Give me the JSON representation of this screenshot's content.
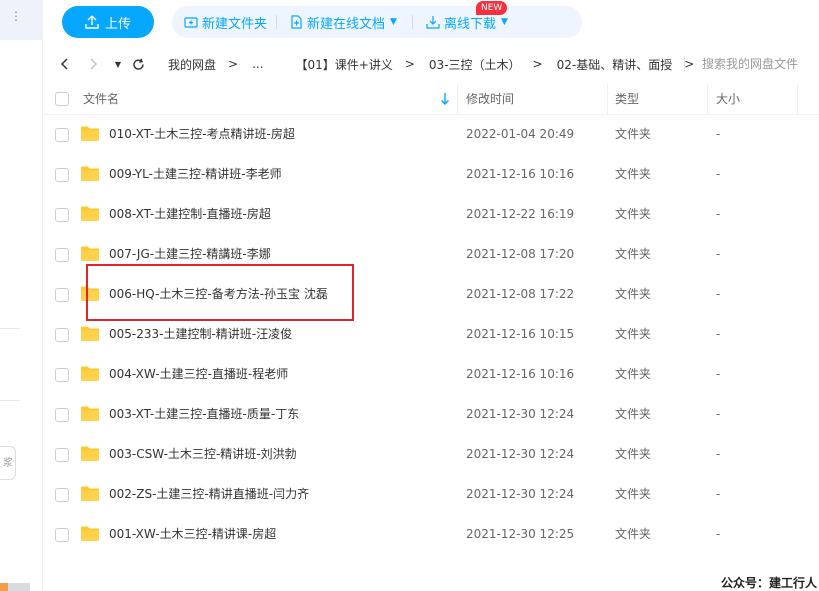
{
  "toolbar": {
    "upload_label": "上传",
    "new_folder_label": "新建文件夹",
    "new_online_doc_label": "新建在线文档",
    "new_badge": "NEW",
    "offline_download_label": "离线下载"
  },
  "nav": {
    "back_icon": "arrow-left-icon",
    "forward_icon": "arrow-right-icon",
    "refresh_icon": "refresh-icon",
    "breadcrumbs": [
      "我的网盘",
      "...",
      "【01】课件+讲义",
      "03-三控（土木）",
      "02-基础、精讲、面授"
    ],
    "separator": ">",
    "search_placeholder": "搜索我的网盘文件"
  },
  "columns": {
    "name": "文件名",
    "modified": "修改时间",
    "type": "类型",
    "size": "大小"
  },
  "files": [
    {
      "name": "010-XT-土木三控-考点精讲班-房超",
      "modified": "2022-01-04 20:49",
      "type": "文件夹",
      "size": "-"
    },
    {
      "name": "009-YL-土建三控-精讲班-李老师",
      "modified": "2021-12-16 10:16",
      "type": "文件夹",
      "size": "-"
    },
    {
      "name": "008-XT-土建控制-直播班-房超",
      "modified": "2021-12-22 16:19",
      "type": "文件夹",
      "size": "-"
    },
    {
      "name": "007-JG-土建三控-精講班-李娜",
      "modified": "2021-12-08 17:20",
      "type": "文件夹",
      "size": "-"
    },
    {
      "name": "006-HQ-土木三控-备考方法-孙玉宝 沈磊",
      "modified": "2021-12-08 17:22",
      "type": "文件夹",
      "size": "-"
    },
    {
      "name": "005-233-土建控制-精讲班-汪凌俊",
      "modified": "2021-12-16 10:15",
      "type": "文件夹",
      "size": "-"
    },
    {
      "name": "004-XW-土建三控-直播班-程老师",
      "modified": "2021-12-16 10:16",
      "type": "文件夹",
      "size": "-"
    },
    {
      "name": "003-XT-土建三控-直播班-质量-丁东",
      "modified": "2021-12-30 12:24",
      "type": "文件夹",
      "size": "-"
    },
    {
      "name": "003-CSW-土木三控-精讲班-刘洪勃",
      "modified": "2021-12-30 12:24",
      "type": "文件夹",
      "size": "-"
    },
    {
      "name": "002-ZS-土建三控-精讲直播班-闫力齐",
      "modified": "2021-12-30 12:24",
      "type": "文件夹",
      "size": "-"
    },
    {
      "name": "001-XW-土木三控-精讲课-房超",
      "modified": "2021-12-30 12:25",
      "type": "文件夹",
      "size": "-"
    }
  ],
  "left_rail": {
    "partial_label": " "
  },
  "watermark": "公众号：建工行人",
  "colors": {
    "accent": "#06a7ff",
    "folder": "#ffc730",
    "highlight": "#e0242e"
  }
}
